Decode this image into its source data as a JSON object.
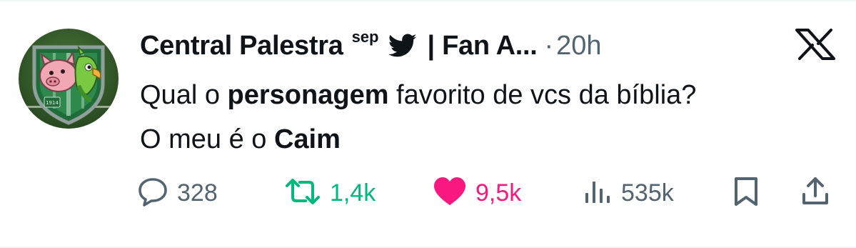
{
  "author": {
    "name": "Central Palestra",
    "superscript": "sep",
    "handle_tail": "| Fan A...",
    "separator": "·",
    "time": "20h"
  },
  "tweet": {
    "line1_a": "Qual o ",
    "line1_b": "personagem",
    "line1_c": " favorito de vcs da bíblia?",
    "line2_a": "O meu é o ",
    "line2_b": "Caim"
  },
  "avatar": {
    "badge_year": "1914"
  },
  "actions": {
    "replies": "328",
    "retweets": "1,4k",
    "likes": "9,5k",
    "views": "535k"
  },
  "colors": {
    "text": "#0f1419",
    "muted": "#536471",
    "retweet": "#00ba7c",
    "like": "#f91880",
    "bird": "#0f1419"
  },
  "icons": {
    "platform": "x-logo-icon",
    "verified": "bird-icon",
    "reply": "reply-icon",
    "retweet": "retweet-icon",
    "like": "heart-icon",
    "views": "views-icon",
    "bookmark": "bookmark-icon",
    "share": "share-icon"
  }
}
